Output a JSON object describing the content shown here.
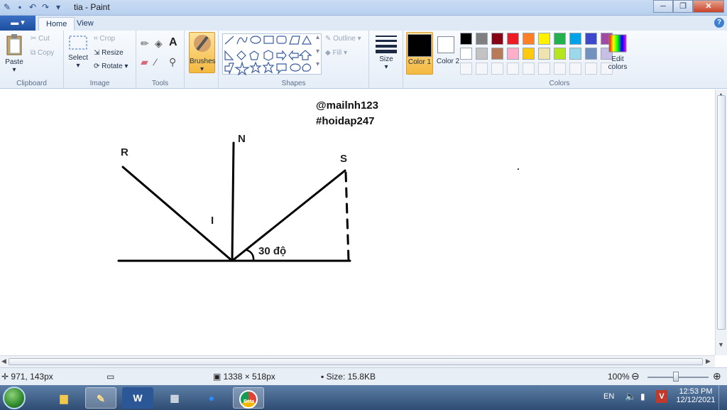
{
  "window": {
    "title": "tia - Paint",
    "minimize_glyph": "─",
    "maximize_glyph": "❐",
    "close_glyph": "✕"
  },
  "tabs": {
    "app_menu": "▾",
    "home": "Home",
    "view": "View",
    "help": "?"
  },
  "ribbon": {
    "clipboard": {
      "label": "Clipboard",
      "paste": "Paste",
      "cut": "Cut",
      "copy": "Copy"
    },
    "image": {
      "label": "Image",
      "select": "Select",
      "crop": "Crop",
      "resize": "Resize",
      "rotate": "Rotate"
    },
    "tools": {
      "label": "Tools"
    },
    "brushes": {
      "label": "Brushes"
    },
    "shapes": {
      "label": "Shapes",
      "outline": "Outline",
      "fill": "Fill"
    },
    "size": {
      "label": "Size"
    },
    "colors": {
      "label": "Colors",
      "color1": "Color 1",
      "color2": "Color 2",
      "edit": "Edit colors",
      "row1": [
        "#000000",
        "#7f7f7f",
        "#880015",
        "#ed1c24",
        "#ff7f27",
        "#fff200",
        "#22b14c",
        "#00a2e8",
        "#3f48cc",
        "#a349a4"
      ],
      "row2": [
        "#ffffff",
        "#c3c3c3",
        "#b97a57",
        "#ffaec9",
        "#ffc90e",
        "#efe4b0",
        "#b5e61d",
        "#99d9ea",
        "#7092be",
        "#c8bfe7"
      ],
      "color1_value": "#000000",
      "color2_value": "#ffffff"
    }
  },
  "canvas": {
    "watermark_user": "@mailnh123",
    "watermark_tag": "#hoidap247",
    "label_R": "R",
    "label_N": "N",
    "label_S": "S",
    "label_I": "I",
    "angle_label": "30 độ"
  },
  "status": {
    "cursor_pos": "971, 143px",
    "image_dims": "1338 × 518px",
    "file_size": "Size: 15.8KB",
    "zoom": "100%"
  },
  "taskbar": {
    "lang": "EN",
    "time": "12:53 PM",
    "date": "12/12/2021",
    "chrome_badge": "Beta"
  }
}
